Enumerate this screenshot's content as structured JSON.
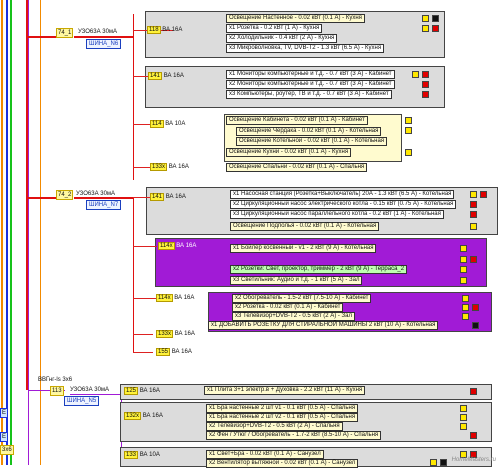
{
  "groups": [
    {
      "rcd": "УЗО63А 30мА",
      "rcd_id": "74_1",
      "bus": "ШИНА_N6",
      "breakers": [
        {
          "id": "118",
          "rating": "ВА 16А",
          "lines": [
            {
              "label": "Освещение Настенное - 0.02 кВт (0.1 А) - Кухня"
            },
            {
              "label": "x1 Розетка - 0.2 кВт (1 А) - Кухня"
            },
            {
              "label": "x2 Холодильник - 0.4 кВт (2 А) - Кухня"
            },
            {
              "label": "x3 Микроволновка, TV, DVB-T2 - 1.3 кВт (6.5 А) - Кухня"
            }
          ]
        },
        {
          "id": "141",
          "rating": "ВА 16А",
          "lines": [
            {
              "label": "x1 Мониторы компьютерные и т.д. - 0.7 кВт (3 А) - Кабинет"
            },
            {
              "label": "x2 Мониторы компьютерные и т.д. - 0.7 кВт (3 А) - Кабинет"
            },
            {
              "label": "x3 Компьютеры, роутер, ТВ и т.д. - 0.7 кВт (3 А) - Кабинет"
            }
          ]
        },
        {
          "id": "114",
          "rating": "ВА 10А",
          "lines": [
            {
              "label": "Освещение Кабинета - 0.02 кВт (0.1 А) - Кабинет"
            },
            {
              "label": "Освещение Чердака - 0.02 кВт (0.1 А) - Котельная"
            },
            {
              "label": "Освещение Котельной - 0.02 кВт (0.1 А) - Котельная"
            },
            {
              "label": "Освещение Кухни - 0.02 кВт (0.1 А) - Кухня"
            }
          ]
        },
        {
          "id": "133x",
          "rating": "ВА 16А",
          "lines": [
            {
              "label": "Освещение Спальни - 0.02 кВт (0.1 А) - Спальня"
            }
          ]
        }
      ]
    },
    {
      "rcd": "УЗО63А 30мА",
      "rcd_id": "74_2",
      "bus": "ШИНА_N7",
      "breakers": [
        {
          "id": "141",
          "rating": "ВА 16А",
          "lines": [
            {
              "label": "x1 Насосная станция (Розетка+Выключатель) 20А - 1.3 кВт (6.5 А) - Котельная"
            },
            {
              "label": "x2 Циркуляционный насос электрического котла - 0.15 кВт (0.75 А) - Котельная"
            },
            {
              "label": "x3 Циркуляционный насос параллельного котла - 0.2 кВт (1 А) - Котельная"
            },
            {
              "label": "Освещение Подполья - 0.02 кВт (0.1 А) - Котельная"
            }
          ]
        },
        {
          "id": "114x",
          "rating": "ВА 16А",
          "lines": [
            {
              "label": "x1 Бойлер косвенный - v1 - 2 кВт (9 А) - Котельная"
            },
            {
              "label": "x2 Розетки: Свет, проектор, триммер - 2 кВт (9 А) - Терраса_2"
            },
            {
              "label": "x3 Светильник: Аудио и т.д. - 1 кВт (5 А) - Зал"
            }
          ]
        },
        {
          "id": "114x",
          "rating": "ВА 16А",
          "lines": [
            {
              "label": "x2 Обогреватель - 1.5-2 кВт (7.5-10 А) - Кабинет"
            },
            {
              "label": "x2 Розетка - 0.02 кВт (0.1 А) - Кабинет"
            },
            {
              "label": "x3 Телевизор+DVB-T2 - 0.5 кВт (2 А) - Зал"
            },
            {
              "label": "x1 ДОБАВИТЬ РОЗЕТКУ ДЛЯ СТИРАЛЬНОЙ МАШИНЫ 2 кВт (10 А) - Котельная"
            }
          ]
        },
        {
          "id": "133x",
          "rating": "ВА 16А",
          "lines": []
        },
        {
          "id": "155",
          "rating": "ВА 16А",
          "lines": []
        }
      ]
    },
    {
      "rcd": "УЗО63А 30мА",
      "rcd_id": "113",
      "bus": "ШИНА_N5",
      "cable": "ВВГнг-ls 3х6",
      "breakers": [
        {
          "id": "125",
          "rating": "ВА 16А",
          "lines": [
            {
              "label": "x1 Плита 3+1 электр.в + Духовка - 2.2 кВт (11 А) - Кухня"
            }
          ]
        },
        {
          "id": "132x",
          "rating": "ВА 16А",
          "lines": [
            {
              "label": "x1 Бра настенные 2 шт v1 - 0.1 кВт (0.5 А) - Спальня"
            },
            {
              "label": "x1 Бра настенные 2 шт v2 - 0.1 кВт (0.5 А) - Спальня"
            },
            {
              "label": "x2 Телевизор+DVB-T2 - 0.5 кВт (2 А) - Спальня"
            },
            {
              "label": "x2 Фен / Утюг / Обогреватель - 1.7-2 кВт (8.5-10 А) - Спальня"
            }
          ]
        },
        {
          "id": "133",
          "rating": "ВА 10А",
          "lines": [
            {
              "label": "x1 Свет+Бра - 0.02 кВт (0.1 А) - Санузел"
            },
            {
              "label": "x2 Вентилятор вытяжной - 0.02 кВт (0.1 А) - Санузел"
            }
          ]
        }
      ]
    }
  ],
  "left_labels": {
    "e_top": "E",
    "e_bot": "E",
    "n3b": "3x6"
  },
  "watermark": "HomeMasters.ru",
  "colors": {
    "wire": "#e01010",
    "purple": "#a11bd6",
    "gray": "#dcdcdc",
    "yellow": "#ffe800"
  }
}
